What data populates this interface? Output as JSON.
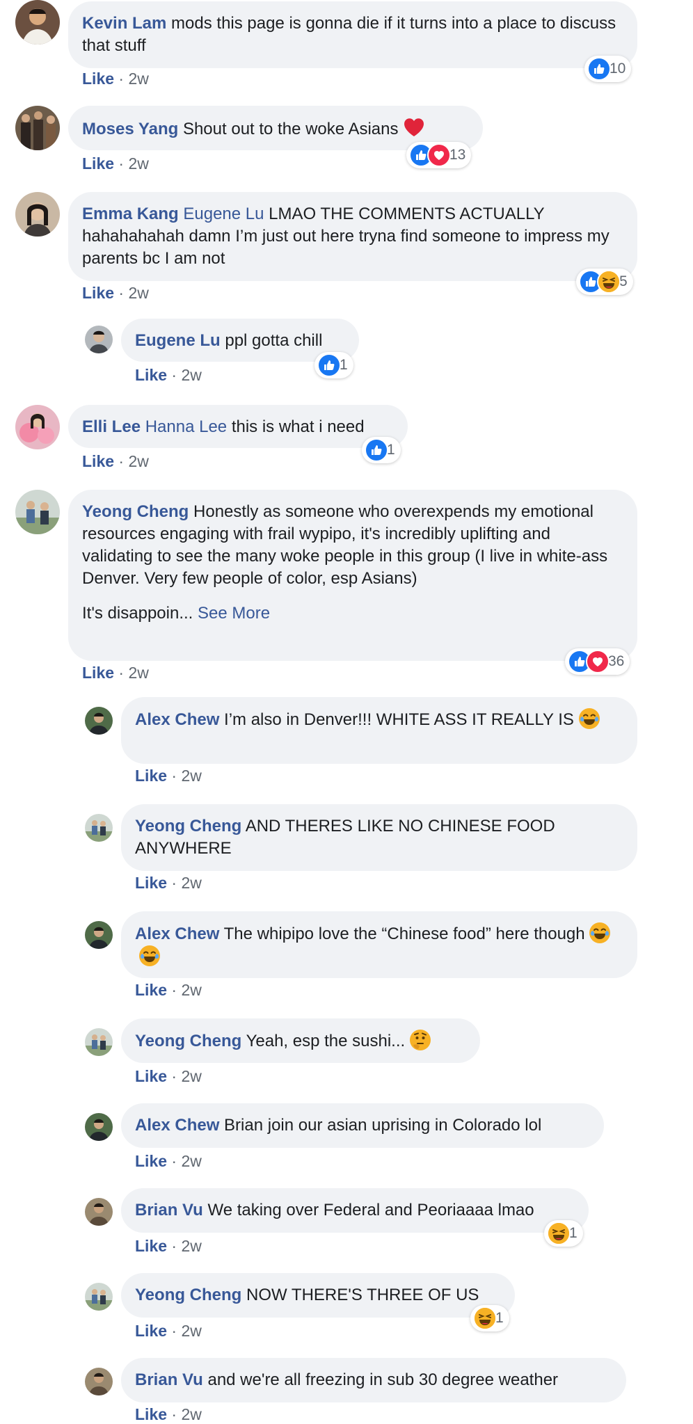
{
  "colors": {
    "name_link": "#385898",
    "bubble_bg": "#f0f2f5",
    "like_blue": "#1877f2",
    "love_red": "#f0284a",
    "haha_yellow": "#f7b125",
    "meta_gray": "#606770"
  },
  "comments": [
    {
      "author": "Kevin Lam",
      "text": "mods this page is gonna die if it turns into a place to discuss that stuff",
      "like_label": "Like",
      "time": "2w",
      "reactions": [
        "like"
      ],
      "reaction_count": "10"
    },
    {
      "author": "Moses Yang",
      "text": "Shout out to the woke Asians",
      "inline_emoji": "red-heart",
      "like_label": "Like",
      "time": "2w",
      "reactions": [
        "like",
        "love"
      ],
      "reaction_count": "13"
    },
    {
      "author": "Emma Kang",
      "mention": "Eugene Lu",
      "text": "LMAO THE COMMENTS ACTUALLY hahahahahah damn I’m just out here tryna find someone to impress my parents bc I am not",
      "like_label": "Like",
      "time": "2w",
      "reactions": [
        "like",
        "haha"
      ],
      "reaction_count": "5",
      "replies": [
        {
          "author": "Eugene Lu",
          "text": "ppl gotta chill",
          "like_label": "Like",
          "time": "2w",
          "reactions": [
            "like"
          ],
          "reaction_count": "1"
        }
      ]
    },
    {
      "author": "Elli Lee",
      "mention": "Hanna Lee",
      "text": "this is what i need",
      "like_label": "Like",
      "time": "2w",
      "reactions": [
        "like"
      ],
      "reaction_count": "1"
    },
    {
      "author": "Yeong Cheng",
      "text": "Honestly as someone who overexpends my emotional resources engaging with frail wypipo, it's incredibly uplifting and validating to see the many woke people in this group (I live in white-ass Denver. Very few people of color, esp Asians)",
      "text_second": "It's disappoin...",
      "see_more": "See More",
      "like_label": "Like",
      "time": "2w",
      "reactions": [
        "like",
        "love"
      ],
      "reaction_count": "36",
      "replies": [
        {
          "author": "Alex Chew",
          "text": "I’m also in Denver!!! WHITE ASS IT REALLY IS",
          "inline_emoji": "tears-of-joy",
          "like_label": "Like",
          "time": "2w"
        },
        {
          "author": "Yeong Cheng",
          "text": "AND THERES LIKE NO CHINESE FOOD ANYWHERE",
          "like_label": "Like",
          "time": "2w"
        },
        {
          "author": "Alex Chew",
          "text": "The whipipo love the “Chinese food” here though",
          "inline_emoji": "tears-of-joy x2",
          "like_label": "Like",
          "time": "2w"
        },
        {
          "author": "Yeong Cheng",
          "text": "Yeah, esp the sushi...",
          "inline_emoji": "thinking-face",
          "like_label": "Like",
          "time": "2w"
        },
        {
          "author": "Alex Chew",
          "text": "Brian join our asian uprising in Colorado lol",
          "like_label": "Like",
          "time": "2w"
        },
        {
          "author": "Brian Vu",
          "text": "We taking over Federal and Peoriaaaa lmao",
          "like_label": "Like",
          "time": "2w",
          "reactions": [
            "haha"
          ],
          "reaction_count": "1"
        },
        {
          "author": "Yeong Cheng",
          "text": "NOW THERE'S THREE OF US",
          "like_label": "Like",
          "time": "2w",
          "reactions": [
            "haha"
          ],
          "reaction_count": "1"
        },
        {
          "author": "Brian Vu",
          "text": "and we're all freezing in sub 30 degree weather",
          "like_label": "Like",
          "time": "2w"
        }
      ]
    }
  ],
  "separator": "·"
}
